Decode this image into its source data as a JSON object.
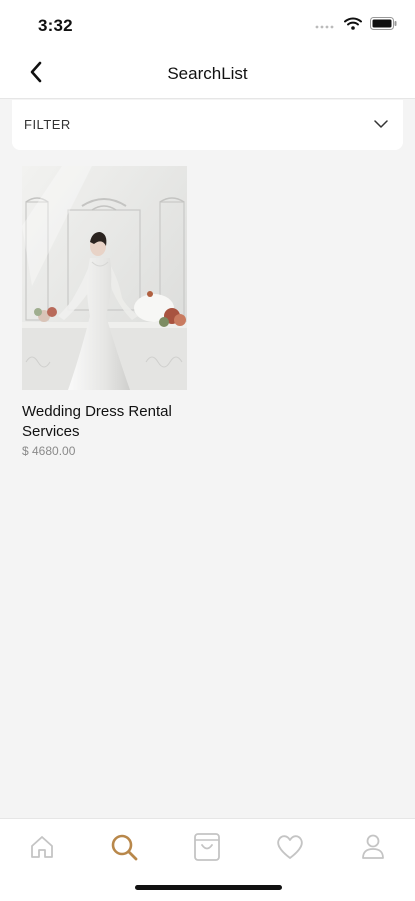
{
  "status_bar": {
    "time": "3:32"
  },
  "nav": {
    "title": "SearchList"
  },
  "filter": {
    "label": "FILTER"
  },
  "products": [
    {
      "title": "Wedding Dress Rental Services",
      "price": "$ 4680.00"
    }
  ],
  "tab_bar": {
    "active_tab": "search",
    "active_color": "#b8874a",
    "inactive_color": "#c4c4c4",
    "tabs": [
      "home-icon",
      "search-icon",
      "bag-icon",
      "heart-icon",
      "profile-icon"
    ]
  }
}
